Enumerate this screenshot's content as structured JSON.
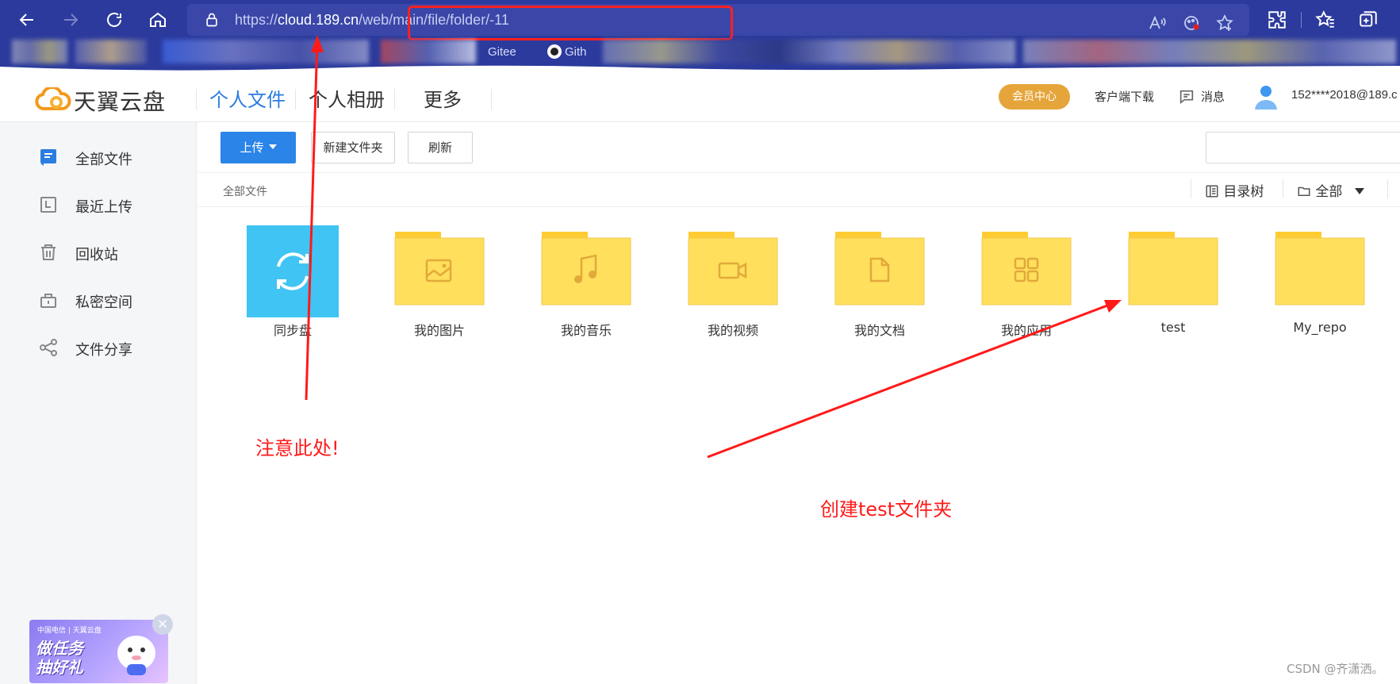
{
  "browser": {
    "url_prefix": "https://",
    "url_domain": "cloud.189.cn",
    "url_path": "/web/main/file/folder/-11",
    "bookmark_labels": [
      "Gitee",
      "Gith"
    ]
  },
  "app": {
    "logo_text": "天翼云盘",
    "nav": [
      "个人文件",
      "个人相册",
      "更多"
    ],
    "vip_label": "会员中心",
    "client_download": "客户端下载",
    "messages": "消息",
    "account": "152****2018@189.c"
  },
  "sidebar": {
    "items": [
      {
        "label": "全部文件",
        "icon": "file-list-icon"
      },
      {
        "label": "最近上传",
        "icon": "recent-icon"
      },
      {
        "label": "回收站",
        "icon": "trash-icon"
      },
      {
        "label": "私密空间",
        "icon": "lock-box-icon"
      },
      {
        "label": "文件分享",
        "icon": "share-icon"
      }
    ],
    "promo": {
      "brand": "中国电信 | 天翼云盘",
      "title_line1": "做任务",
      "title_line2": "抽好礼"
    }
  },
  "toolbar": {
    "upload": "上传",
    "new_folder": "新建文件夹",
    "refresh": "刷新"
  },
  "breadcrumb": "全部文件",
  "view": {
    "tree_label": "目录树",
    "filter_label": "全部"
  },
  "files": [
    {
      "name": "同步盘",
      "type": "sync-folder-icon"
    },
    {
      "name": "我的图片",
      "type": "image-folder-icon"
    },
    {
      "name": "我的音乐",
      "type": "music-folder-icon"
    },
    {
      "name": "我的视频",
      "type": "video-folder-icon"
    },
    {
      "name": "我的文档",
      "type": "document-folder-icon"
    },
    {
      "name": "我的应用",
      "type": "app-folder-icon"
    },
    {
      "name": "test",
      "type": "folder-icon"
    },
    {
      "name": "My_repo",
      "type": "folder-icon"
    }
  ],
  "annotations": {
    "note_url": "注意此处!",
    "note_folder": "创建test文件夹",
    "color": "#ff1a1a"
  },
  "watermark": "CSDN @齐潇洒。",
  "colors": {
    "chrome_bg": "#2b3a9c",
    "accent": "#2b7de0",
    "folder": "#ffdf5c",
    "folder_tab": "#ffcc33",
    "sync": "#3fc4f4",
    "vip": "#e5a53a"
  }
}
